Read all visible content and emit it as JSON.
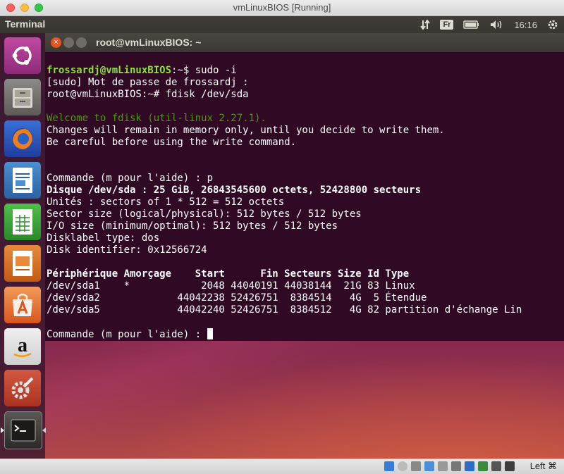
{
  "mac_window": {
    "title": "vmLinuxBIOS [Running]"
  },
  "ubuntu_panel": {
    "app_name": "Terminal",
    "keyboard_layout": "Fr",
    "clock": "16:16",
    "icons": [
      "network-icon",
      "keyboard-icon",
      "battery-icon",
      "volume-icon",
      "power-gear-icon"
    ]
  },
  "launcher": {
    "items": [
      {
        "name": "ubuntu-dash",
        "icon": "ubuntu-logo-icon"
      },
      {
        "name": "files",
        "icon": "file-cabinet-icon"
      },
      {
        "name": "firefox",
        "icon": "firefox-icon"
      },
      {
        "name": "libreoffice-writer",
        "icon": "writer-icon"
      },
      {
        "name": "libreoffice-calc",
        "icon": "calc-icon"
      },
      {
        "name": "libreoffice-impress",
        "icon": "impress-icon"
      },
      {
        "name": "ubuntu-software",
        "icon": "software-bag-icon"
      },
      {
        "name": "amazon",
        "icon": "amazon-icon"
      },
      {
        "name": "system-settings",
        "icon": "settings-wrench-icon"
      },
      {
        "name": "terminal",
        "icon": "terminal-icon"
      }
    ]
  },
  "terminal": {
    "title": "root@vmLinuxBIOS: ~",
    "prompt_user": "frossardj@vmLinuxBIOS",
    "prompt_path": ":~$ ",
    "cmd1": "sudo -i",
    "sudo_line": "[sudo] Mot de passe de frossardj :",
    "root_prompt": "root@vmLinuxBIOS:~# fdisk /dev/sda",
    "welcome": "Welcome to fdisk (util-linux 2.27.1).",
    "changes": "Changes will remain in memory only, until you decide to write them.",
    "careful": "Be careful before using the write command.",
    "cmd_p": "Commande (m pour l'aide) : p",
    "disk_line": "Disque /dev/sda : 25 GiB, 26843545600 octets, 52428800 secteurs",
    "units": "Unités : sectors of 1 * 512 = 512 octets",
    "sector_size": "Sector size (logical/physical): 512 bytes / 512 bytes",
    "io_size": "I/O size (minimum/optimal): 512 bytes / 512 bytes",
    "label_type": "Disklabel type: dos",
    "identifier": "Disk identifier: 0x12566724",
    "table_header": "Périphérique Amorçage    Start      Fin Secteurs Size Id Type",
    "rows": [
      "/dev/sda1    *            2048 44040191 44038144  21G 83 Linux",
      "/dev/sda2             44042238 52426751  8384514   4G  5 Étendue",
      "/dev/sda5             44042240 52426751  8384512   4G 82 partition d'échange Lin"
    ],
    "cmd_prompt": "Commande (m pour l'aide) : "
  },
  "vbox_status": {
    "host_key": "Left ⌘"
  },
  "colors": {
    "accent": "#e95420",
    "terminal_bg": "#300a24",
    "prompt_green": "#8ae234",
    "prompt_blue": "#729fcf"
  }
}
